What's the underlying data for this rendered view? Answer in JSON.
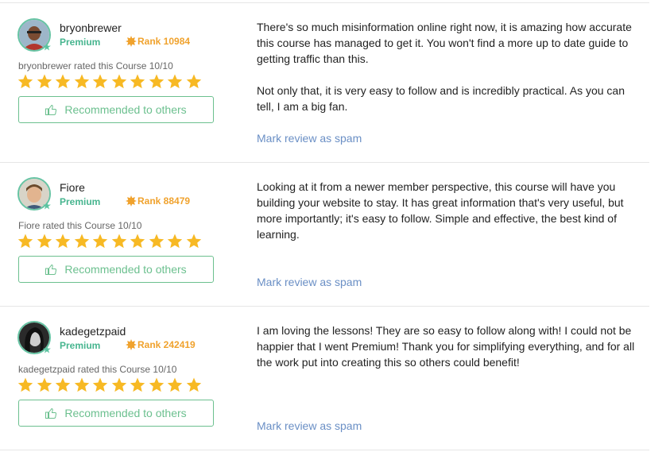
{
  "reviews": [
    {
      "username": "bryonbrewer",
      "membership": "Premium",
      "rank": "Rank 10984",
      "rated_text": "bryonbrewer rated this Course 10/10",
      "rating": 10,
      "max_rating": 10,
      "recommend_label": "Recommended to others",
      "paragraphs": [
        "There's so much misinformation online right now, it is amazing how accurate this course has managed to get it. You won't find a more up to date guide to getting traffic than this.",
        "Not only that, it is very easy to follow and is incredibly practical. As you can tell, I am a big fan."
      ],
      "spam_label": "Mark review as spam",
      "avatar_icon": "user-photo"
    },
    {
      "username": "Fiore",
      "membership": "Premium",
      "rank": "Rank 88479",
      "rated_text": "Fiore rated this Course 10/10",
      "rating": 10,
      "max_rating": 10,
      "recommend_label": "Recommended to others",
      "paragraphs": [
        "Looking at it from a newer member perspective, this course will have you building your website to stay. It has great information that's very useful, but more importantly; it's easy to follow. Simple and effective, the best kind of learning."
      ],
      "spam_label": "Mark review as spam",
      "avatar_icon": "user-photo"
    },
    {
      "username": "kadegetzpaid",
      "membership": "Premium",
      "rank": "Rank 242419",
      "rated_text": "kadegetzpaid rated this Course 10/10",
      "rating": 10,
      "max_rating": 10,
      "recommend_label": "Recommended to others",
      "paragraphs": [
        "I am loving the lessons! They are so easy to follow along with! I could not be happier that I went Premium! Thank you for simplifying everything, and for all the work put into creating this so others could benefit!"
      ],
      "spam_label": "Mark review as spam",
      "avatar_icon": "user-photo"
    }
  ],
  "colors": {
    "premium": "#47b58f",
    "rank": "#f0a22d",
    "star": "#f7b924",
    "recommend": "#6cc08f",
    "spam_link": "#6a8fc5",
    "divider": "#e6e6e6"
  },
  "icons": {
    "rank_badge": "rank-sunburst-icon",
    "star": "star-icon",
    "recommend": "thumbs-up-icon",
    "premium_badge": "premium-star-badge-icon"
  }
}
